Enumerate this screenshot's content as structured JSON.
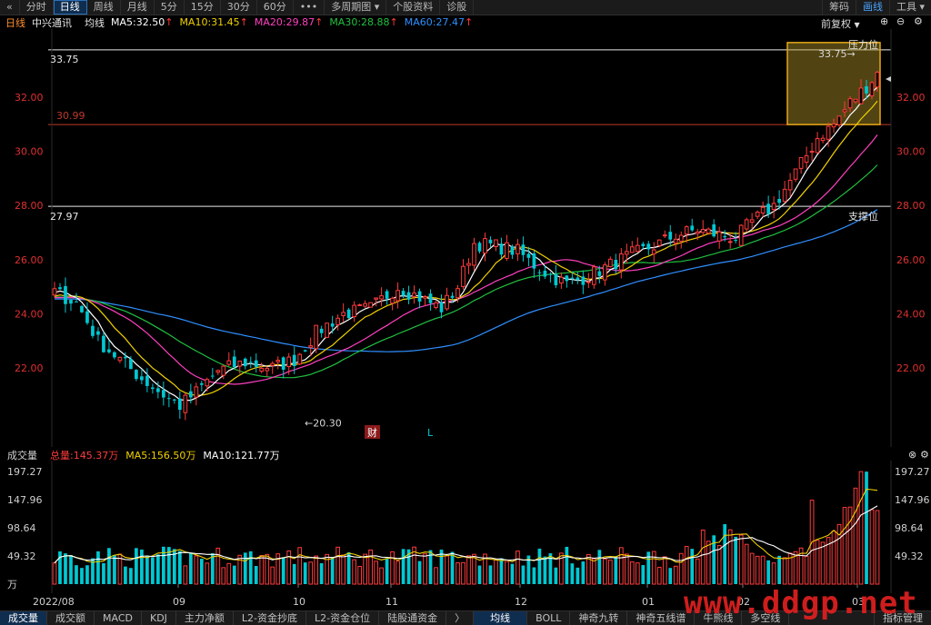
{
  "toolbar": {
    "back_icon": "double-chevron-left-icon",
    "items": [
      {
        "label": "分时",
        "active": false
      },
      {
        "label": "日线",
        "active": true
      },
      {
        "label": "周线",
        "active": false
      },
      {
        "label": "月线",
        "active": false
      },
      {
        "label": "5分",
        "active": false
      },
      {
        "label": "15分",
        "active": false
      },
      {
        "label": "30分",
        "active": false
      },
      {
        "label": "60分",
        "active": false
      },
      {
        "label": "•••",
        "active": false
      },
      {
        "label": "多周期图 ▾",
        "active": false
      },
      {
        "label": "个股资料",
        "active": false
      },
      {
        "label": "诊股",
        "active": false
      }
    ],
    "right_items": [
      {
        "label": "筹码",
        "highlight": false
      },
      {
        "label": "画线",
        "highlight": true
      },
      {
        "label": "工具 ▾",
        "highlight": false
      }
    ]
  },
  "chart_header": {
    "period": "日线",
    "stock_name": "中兴通讯",
    "line_type": "均线",
    "ma5": "MA5:32.50",
    "ma10": "MA10:31.45",
    "ma20": "MA20:29.87",
    "ma30": "MA30:28.88",
    "ma60": "MA60:27.47",
    "adjust": "前复权",
    "adjust_icon": "chevron-down-icon",
    "zoom_in_icon": "plus-circle-icon",
    "zoom_out_icon": "minus-circle-icon",
    "settings_icon": "gear-icon"
  },
  "annotations": {
    "high_line_value": "33.75",
    "high_marker": "33.75→",
    "resistance_label": "压力位",
    "mid_line_value": "30.99",
    "support_line_value": "27.97",
    "support_label": "支撑位",
    "low_marker": "←20.30",
    "news_marker": "财",
    "l_marker": "L"
  },
  "price_axis": {
    "ticks": [
      "32.00",
      "30.00",
      "28.00",
      "26.00",
      "24.00",
      "22.00"
    ]
  },
  "volume_panel": {
    "label": "成交量",
    "total": "总量:145.37万",
    "ma5": "MA5:156.50万",
    "ma10": "MA10:121.77万",
    "close_icon": "close-circle-icon",
    "settings_icon": "gear-icon",
    "ticks": [
      "197.27",
      "147.96",
      "98.64",
      "49.32",
      "万"
    ]
  },
  "date_axis": {
    "labels": [
      "2022/08",
      "09",
      "10",
      "11",
      "12",
      "01",
      "02",
      "03"
    ]
  },
  "bottom_tabs": [
    {
      "label": "成交量",
      "active": true
    },
    {
      "label": "成交额",
      "active": false
    },
    {
      "label": "MACD",
      "active": false
    },
    {
      "label": "KDJ",
      "active": false
    },
    {
      "label": "主力净额",
      "active": false
    },
    {
      "label": "L2-资金抄底",
      "active": false
    },
    {
      "label": "L2-资金仓位",
      "active": false
    },
    {
      "label": "陆股通资金",
      "active": false
    },
    {
      "label": "〉",
      "active": false
    },
    {
      "label": "均线",
      "active": true
    },
    {
      "label": "BOLL",
      "active": false
    },
    {
      "label": "神奇九转",
      "active": false
    },
    {
      "label": "神奇五线谱",
      "active": false
    },
    {
      "label": "牛熊线",
      "active": false
    },
    {
      "label": "多空线",
      "active": false
    },
    {
      "label": "指标管理",
      "active": false
    }
  ],
  "watermark": "www.ddgp.net",
  "colors": {
    "up": "#ff3b3b",
    "down": "#00c8d2",
    "ma5": "#ffffff",
    "ma10": "#f0d000",
    "ma20": "#ff40c0",
    "ma30": "#20c040",
    "ma60": "#2f8fff"
  }
}
